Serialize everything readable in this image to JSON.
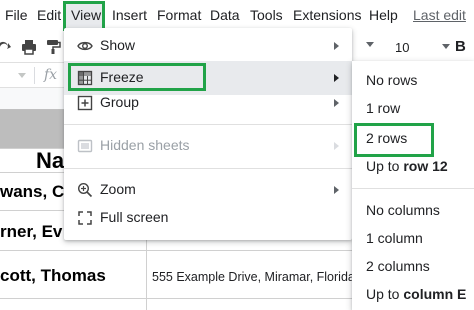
{
  "menubar": {
    "items": [
      "File",
      "Edit",
      "View",
      "Insert",
      "Format",
      "Data",
      "Tools",
      "Extensions",
      "Help"
    ],
    "last_edit": "Last edit"
  },
  "toolbar": {
    "font_size": "10",
    "bold_label": "B"
  },
  "formula_bar": {
    "fx_label": "fx"
  },
  "sheet": {
    "name_header": "Na",
    "rows": [
      {
        "name": "wans, Cla",
        "address": ""
      },
      {
        "name": "rner, Ev",
        "address": ""
      },
      {
        "name": "cott, Thomas",
        "address": "555 Example Drive, Miramar, Florida"
      }
    ]
  },
  "view_menu": {
    "items": [
      {
        "label": "Show",
        "icon": "eye-icon",
        "submenu": true,
        "disabled": false
      },
      {
        "label": "Freeze",
        "icon": "freeze-grid-icon",
        "submenu": true,
        "disabled": false,
        "highlighted": true
      },
      {
        "label": "Group",
        "icon": "group-plus-icon",
        "submenu": true,
        "disabled": false
      },
      {
        "label": "Hidden sheets",
        "icon": "hidden-sheets-icon",
        "submenu": true,
        "disabled": true
      },
      {
        "label": "Zoom",
        "icon": "zoom-icon",
        "submenu": true,
        "disabled": false
      },
      {
        "label": "Full screen",
        "icon": "fullscreen-icon",
        "submenu": false,
        "disabled": false
      }
    ]
  },
  "freeze_submenu": {
    "rows": [
      {
        "label": "No rows"
      },
      {
        "label": "1 row"
      },
      {
        "label": "2 rows",
        "highlighted": true
      },
      {
        "label_prefix": "Up to ",
        "label_bold": "row 12"
      }
    ],
    "columns": [
      {
        "label": "No columns"
      },
      {
        "label": "1 column"
      },
      {
        "label": "2 columns"
      },
      {
        "label_prefix": "Up to ",
        "label_bold": "column E"
      }
    ]
  },
  "colors": {
    "highlight_border": "#21a348",
    "menu_hover": "#e8eaed",
    "text": "#202124",
    "disabled_text": "#9aa0a6"
  }
}
